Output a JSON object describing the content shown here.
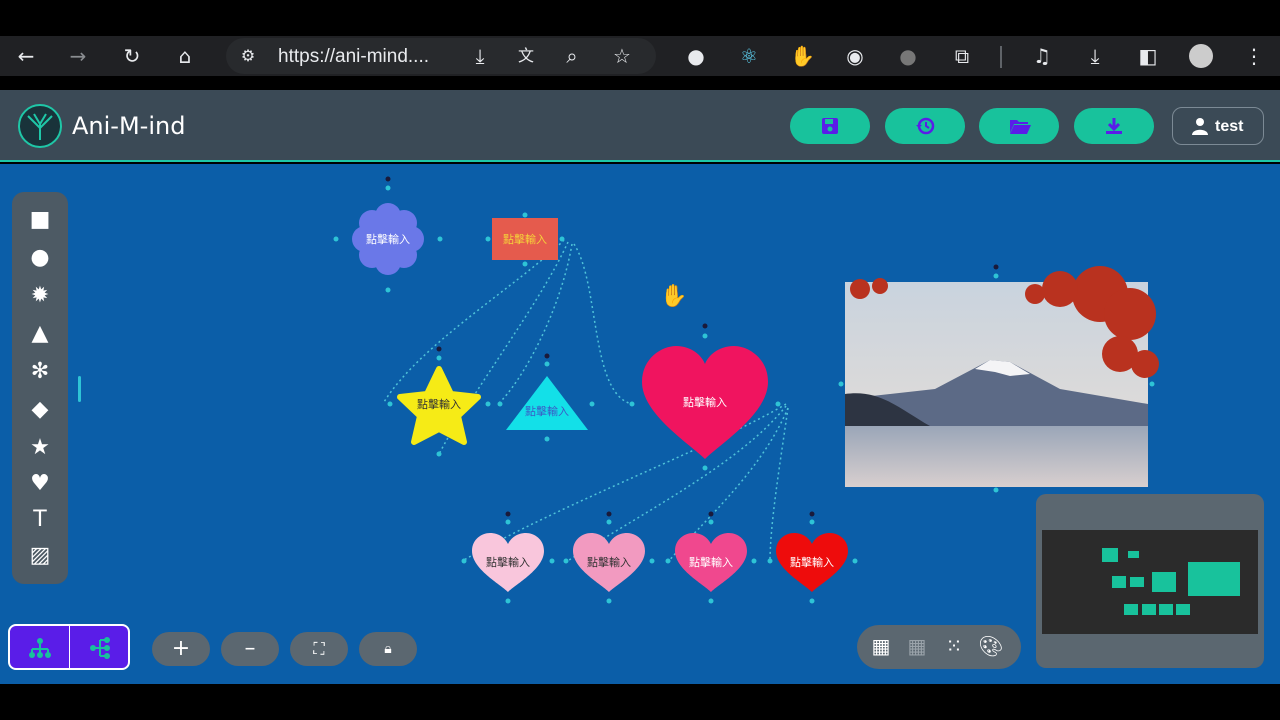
{
  "browser": {
    "url": "https://ani-mind....",
    "icons": [
      "back-icon",
      "forward-icon",
      "reload-icon",
      "home-icon",
      "site-settings-icon",
      "download-icon",
      "translate-icon",
      "zoom-icon",
      "bookmark-star-icon",
      "extension-icon",
      "extensions-puzzle-icon",
      "media-icon",
      "downloads-icon",
      "sidebar-icon",
      "profile-avatar-icon",
      "menu-icon"
    ]
  },
  "app": {
    "title": "Ani-M-ind",
    "user_label": "test",
    "header_buttons": [
      "save-icon",
      "history-icon",
      "open-folder-icon",
      "download-icon"
    ],
    "accent": "#18c29c",
    "canvas_bg": "#0b5ea8"
  },
  "toolbar": {
    "tools": [
      "square-icon",
      "circle-icon",
      "cloud-icon",
      "triangle-icon",
      "asterisk-flower-icon",
      "diamond-icon",
      "star-icon",
      "heart-icon",
      "text-icon",
      "image-icon"
    ]
  },
  "nodes": {
    "flower": "點擊輸入",
    "rect": "點擊輸入",
    "star": "點擊輸入",
    "triangle": "點擊輸入",
    "big_heart": "點擊輸入",
    "heart1": "點擊輸入",
    "heart2": "點擊輸入",
    "heart3": "點擊輸入",
    "heart4": "點擊輸入"
  },
  "controls": {
    "zoom": [
      "+",
      "–"
    ],
    "bg_options": [
      "grid-icon",
      "dot-grid-faint-icon",
      "dots-icon",
      "palette-icon"
    ]
  }
}
